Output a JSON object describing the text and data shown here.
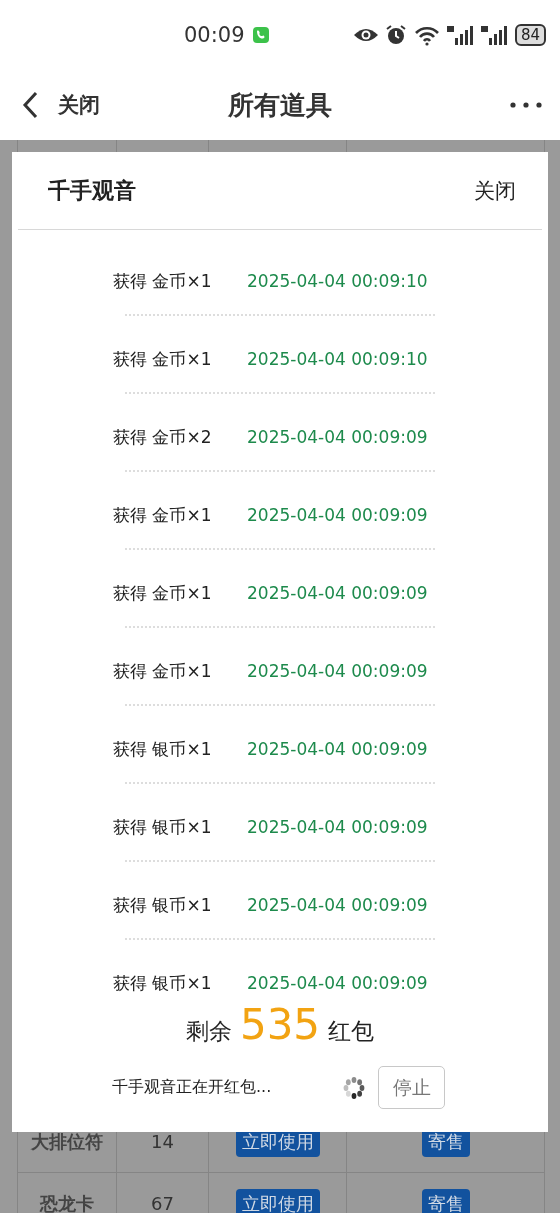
{
  "status_bar": {
    "time": "00:09",
    "battery": "84"
  },
  "nav": {
    "back_label": "关闭",
    "title": "所有道具"
  },
  "table": {
    "rows": [
      {
        "name": "大排位符",
        "count": "14",
        "use_button": "立即使用",
        "sell_button": "寄售"
      },
      {
        "name": "恐龙卡",
        "count": "67",
        "use_button": "立即使用",
        "sell_button": "寄售"
      }
    ]
  },
  "modal": {
    "title": "千手观音",
    "close": "关闭",
    "records": [
      {
        "action": "获得",
        "item": "金币×1",
        "time": "2025-04-04 00:09:10"
      },
      {
        "action": "获得",
        "item": "金币×1",
        "time": "2025-04-04 00:09:10"
      },
      {
        "action": "获得",
        "item": "金币×2",
        "time": "2025-04-04 00:09:09"
      },
      {
        "action": "获得",
        "item": "金币×1",
        "time": "2025-04-04 00:09:09"
      },
      {
        "action": "获得",
        "item": "金币×1",
        "time": "2025-04-04 00:09:09"
      },
      {
        "action": "获得",
        "item": "金币×1",
        "time": "2025-04-04 00:09:09"
      },
      {
        "action": "获得",
        "item": "银币×1",
        "time": "2025-04-04 00:09:09"
      },
      {
        "action": "获得",
        "item": "银币×1",
        "time": "2025-04-04 00:09:09"
      },
      {
        "action": "获得",
        "item": "银币×1",
        "time": "2025-04-04 00:09:09"
      },
      {
        "action": "获得",
        "item": "银币×1",
        "time": "2025-04-04 00:09:09"
      }
    ],
    "remaining": {
      "prefix": "剩余",
      "count": "535",
      "suffix": "红包"
    },
    "progress_text": "千手观音正在开红包...",
    "stop_button": "停止"
  }
}
